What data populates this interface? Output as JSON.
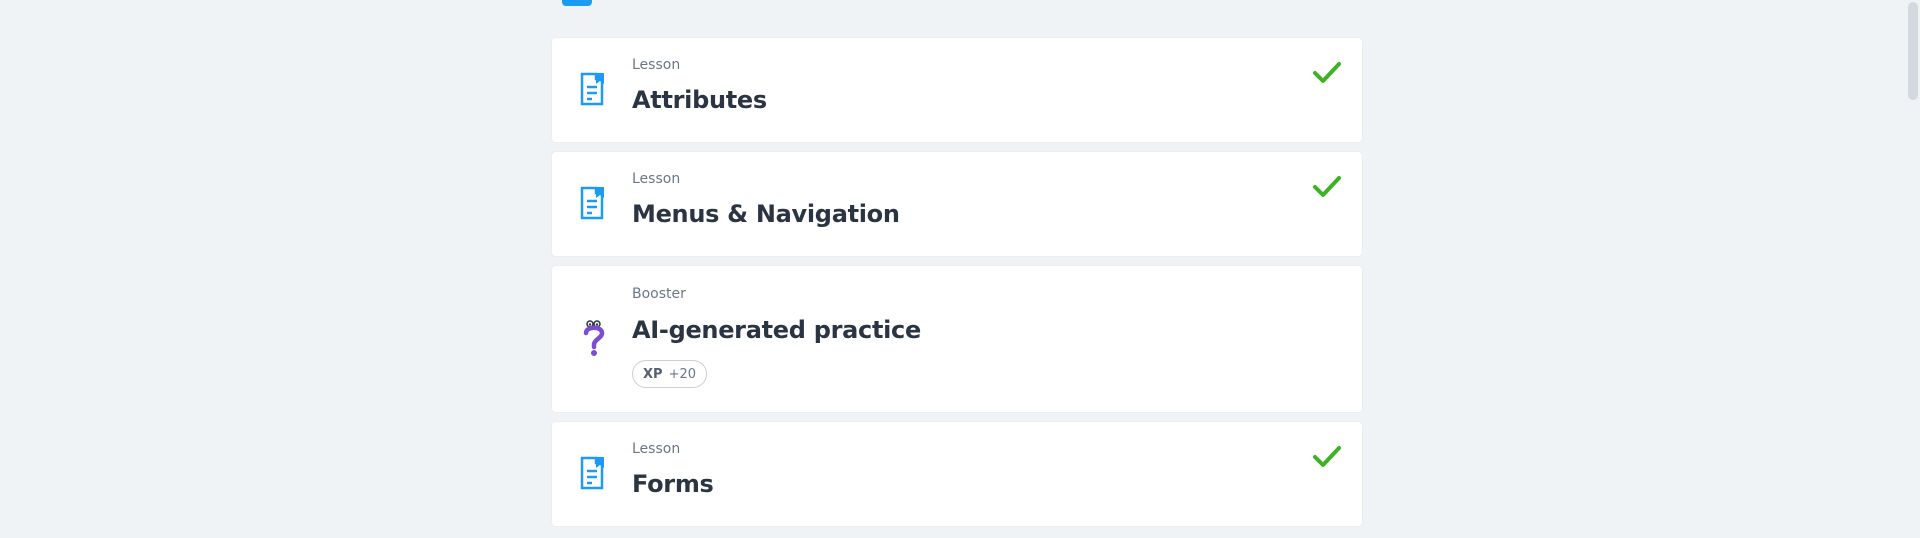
{
  "cards": [
    {
      "type": "Lesson",
      "title": "Attributes",
      "completed": true,
      "icon": "document-bookmark-icon"
    },
    {
      "type": "Lesson",
      "title": "Menus & Navigation",
      "completed": true,
      "icon": "document-bookmark-icon"
    },
    {
      "type": "Booster",
      "title": "AI-generated practice",
      "completed": false,
      "icon": "question-mark-character-icon",
      "xp_label": "XP",
      "xp_value": "+20"
    },
    {
      "type": "Lesson",
      "title": "Forms",
      "completed": true,
      "icon": "document-bookmark-icon"
    }
  ],
  "colors": {
    "background": "#f0f3f6",
    "accent_blue": "#1d9bf0",
    "check_green": "#3db324",
    "booster_purple": "#7c4dce",
    "title_text": "#2b3442"
  }
}
